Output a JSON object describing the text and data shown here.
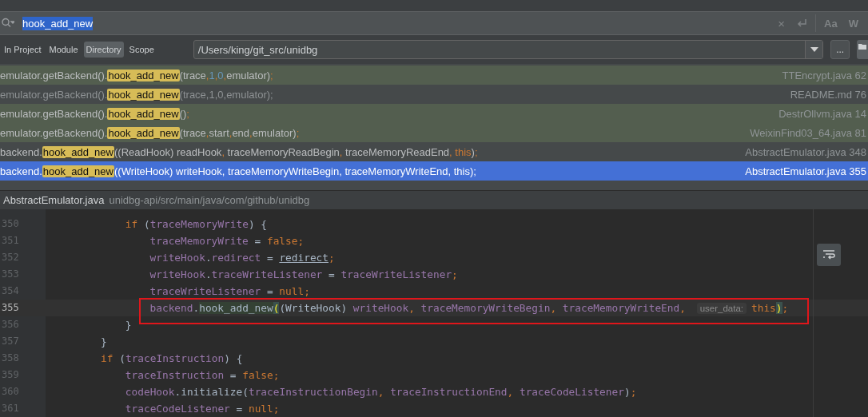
{
  "search": {
    "query": "hook_add_new"
  },
  "search_options": [
    {
      "kind": "clear",
      "label": "×"
    },
    {
      "kind": "newline"
    },
    {
      "kind": "case",
      "label": "Aa"
    },
    {
      "kind": "words",
      "label": "W"
    }
  ],
  "scopes": [
    {
      "label": "In Project",
      "selected": false
    },
    {
      "label": "Module",
      "selected": false
    },
    {
      "label": "Directory",
      "selected": true
    },
    {
      "label": "Scope",
      "selected": false
    }
  ],
  "directory": {
    "value": "/Users/king/git_src/unidbg",
    "browse_label": "..."
  },
  "results": [
    {
      "prefix": "emulator.getBackend().",
      "match": "hook_add_new",
      "suffix": "(trace,1,0,emulator);",
      "file": "TTEncrypt.java 62",
      "highlighted": true,
      "dimmed": false,
      "selected": false
    },
    {
      "prefix": "emulator.getBackend().",
      "match": "hook_add_new",
      "suffix": "(trace,1,0,emulator);",
      "file": "README.md 76",
      "highlighted": false,
      "dimmed": true,
      "selected": false
    },
    {
      "prefix": "emulator.getBackend().",
      "match": "hook_add_new",
      "suffix": "();",
      "file": "DestrOllvm.java 14",
      "highlighted": true,
      "dimmed": false,
      "selected": false
    },
    {
      "prefix": "emulator.getBackend().",
      "match": "hook_add_new",
      "suffix": "(trace,start,end,emulator);",
      "file": "WeixinFind03_64.java 81",
      "highlighted": true,
      "dimmed": false,
      "selected": false
    },
    {
      "prefix": "backend.",
      "match": "hook_add_new",
      "suffix": "((ReadHook) readHook, traceMemoryReadBegin, traceMemoryReadEnd, this);",
      "file": "AbstractEmulator.java 348",
      "highlighted": false,
      "dimmed": false,
      "selected": false
    },
    {
      "prefix": "backend.",
      "match": "hook_add_new",
      "suffix": "((WriteHook) writeHook, traceMemoryWriteBegin, traceMemoryWriteEnd, this);",
      "file": "AbstractEmulator.java 355",
      "highlighted": false,
      "dimmed": false,
      "selected": true
    }
  ],
  "preview": {
    "file": "AbstractEmulator.java",
    "path": "unidbg-api/src/main/java/com/github/unidbg"
  },
  "editor": {
    "lines": [
      {
        "children": [
          {
            "number": "350",
            "current": false,
            "annotated": false,
            "tokens": [
              {
                "kind": "keyword",
                "text": "if"
              },
              {
                "kind": "plain",
                "text": " ("
              },
              {
                "kind": "field",
                "text": "traceMemoryWrite"
              },
              {
                "kind": "plain",
                "text": ") {"
              }
            ],
            "children": [
              {
                "number": "351",
                "current": false,
                "annotated": false,
                "tokens": [
                  {
                    "kind": "field",
                    "text": "traceMemoryWrite"
                  },
                  {
                    "kind": "plain",
                    "text": " = "
                  },
                  {
                    "kind": "keyword",
                    "text": "false;"
                  }
                ]
              },
              {
                "number": "352",
                "current": false,
                "annotated": false,
                "tokens": [
                  {
                    "kind": "field",
                    "text": "writeHook"
                  },
                  {
                    "kind": "plain",
                    "text": "."
                  },
                  {
                    "kind": "field",
                    "text": "redirect"
                  },
                  {
                    "kind": "plain",
                    "text": " = "
                  },
                  {
                    "kind": "underline",
                    "text": "redirect"
                  },
                  {
                    "kind": "punct",
                    "text": ";"
                  }
                ]
              },
              {
                "number": "353",
                "current": false,
                "annotated": false,
                "tokens": [
                  {
                    "kind": "field",
                    "text": "writeHook"
                  },
                  {
                    "kind": "plain",
                    "text": "."
                  },
                  {
                    "kind": "field",
                    "text": "traceWriteListener"
                  },
                  {
                    "kind": "plain",
                    "text": " = "
                  },
                  {
                    "kind": "field",
                    "text": "traceWriteListener"
                  },
                  {
                    "kind": "punct",
                    "text": ";"
                  }
                ]
              },
              {
                "number": "354",
                "current": false,
                "annotated": false,
                "tokens": [
                  {
                    "kind": "field",
                    "text": "traceWriteListener"
                  },
                  {
                    "kind": "plain",
                    "text": " = "
                  },
                  {
                    "kind": "keyword",
                    "text": "null;"
                  }
                ]
              },
              {
                "number": "355",
                "current": true,
                "annotated": true,
                "tokens": [
                  {
                    "kind": "field",
                    "text": "backend"
                  },
                  {
                    "kind": "plain",
                    "text": "."
                  },
                  {
                    "kind": "usage",
                    "text": "hook_add_new"
                  },
                  {
                    "kind": "brace",
                    "text": "("
                  },
                  {
                    "kind": "plain",
                    "text": "(WriteHook) "
                  },
                  {
                    "kind": "field",
                    "text": "writeHook"
                  },
                  {
                    "kind": "punct",
                    "text": ", "
                  },
                  {
                    "kind": "field",
                    "text": "traceMemoryWriteBegin"
                  },
                  {
                    "kind": "punct",
                    "text": ", "
                  },
                  {
                    "kind": "field",
                    "text": "traceMemoryWriteEnd"
                  },
                  {
                    "kind": "punct",
                    "text": ", "
                  },
                  {
                    "kind": "hint",
                    "text": "user_data:"
                  },
                  {
                    "kind": "keyword",
                    "text": "this"
                  },
                  {
                    "kind": "brace",
                    "text": ")"
                  },
                  {
                    "kind": "punct",
                    "text": ";"
                  }
                ]
              }
            ]
          },
          {
            "number": "356",
            "current": false,
            "annotated": false,
            "tokens": [
              {
                "kind": "plain",
                "text": "}"
              }
            ]
          }
        ]
      },
      {
        "number": "357",
        "current": false,
        "annotated": false,
        "tokens": [
          {
            "kind": "plain",
            "text": "}"
          }
        ]
      },
      {
        "number": "358",
        "current": false,
        "annotated": false,
        "tokens": [
          {
            "kind": "keyword",
            "text": "if"
          },
          {
            "kind": "plain",
            "text": " ("
          },
          {
            "kind": "field",
            "text": "traceInstruction"
          },
          {
            "kind": "plain",
            "text": ") {"
          }
        ],
        "children": [
          {
            "number": "359",
            "current": false,
            "annotated": false,
            "tokens": [
              {
                "kind": "field",
                "text": "traceInstruction"
              },
              {
                "kind": "plain",
                "text": " = "
              },
              {
                "kind": "keyword",
                "text": "false;"
              }
            ]
          },
          {
            "number": "360",
            "current": false,
            "annotated": false,
            "tokens": [
              {
                "kind": "field",
                "text": "codeHook"
              },
              {
                "kind": "plain",
                "text": ".initialize("
              },
              {
                "kind": "field",
                "text": "traceInstructionBegin"
              },
              {
                "kind": "punct",
                "text": ", "
              },
              {
                "kind": "field",
                "text": "traceInstructionEnd"
              },
              {
                "kind": "punct",
                "text": ", "
              },
              {
                "kind": "field",
                "text": "traceCodeListener"
              },
              {
                "kind": "plain",
                "text": ")"
              },
              {
                "kind": "punct",
                "text": ";"
              }
            ]
          },
          {
            "number": "361",
            "current": false,
            "annotated": false,
            "tokens": [
              {
                "kind": "field",
                "text": "traceCodeListener"
              },
              {
                "kind": "plain",
                "text": " = "
              },
              {
                "kind": "keyword",
                "text": "null;"
              }
            ]
          }
        ]
      }
    ]
  }
}
